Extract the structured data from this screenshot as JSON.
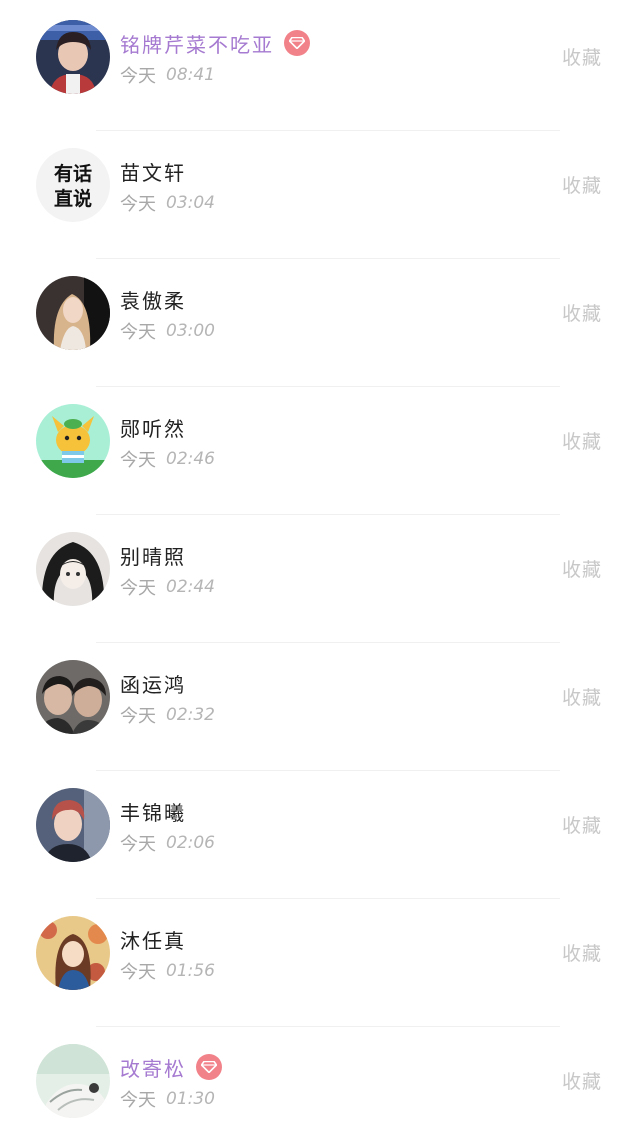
{
  "colors": {
    "vip_name": "#a57ad0",
    "vip_badge": "#f2828a",
    "name": "#222222",
    "secondary": "#a8a8a8",
    "favorite": "#c8c8c8"
  },
  "items": [
    {
      "name": "铭牌芹菜不吃亚",
      "vip": true,
      "day": "今天",
      "time": "08:41",
      "action": "收藏",
      "avatar_icon": "avatar-photo-icon"
    },
    {
      "name": "苗文轩",
      "vip": false,
      "day": "今天",
      "time": "03:04",
      "action": "收藏",
      "avatar_icon": "avatar-text-icon",
      "avatar_text": [
        "有话",
        "直说"
      ]
    },
    {
      "name": "袁傲柔",
      "vip": false,
      "day": "今天",
      "time": "03:00",
      "action": "收藏",
      "avatar_icon": "avatar-photo-icon"
    },
    {
      "name": "郧听然",
      "vip": false,
      "day": "今天",
      "time": "02:46",
      "action": "收藏",
      "avatar_icon": "avatar-cartoon-icon"
    },
    {
      "name": "别晴照",
      "vip": false,
      "day": "今天",
      "time": "02:44",
      "action": "收藏",
      "avatar_icon": "avatar-anime-icon"
    },
    {
      "name": "函运鸿",
      "vip": false,
      "day": "今天",
      "time": "02:32",
      "action": "收藏",
      "avatar_icon": "avatar-photo-icon"
    },
    {
      "name": "丰锦曦",
      "vip": false,
      "day": "今天",
      "time": "02:06",
      "action": "收藏",
      "avatar_icon": "avatar-photo-icon"
    },
    {
      "name": "沐任真",
      "vip": false,
      "day": "今天",
      "time": "01:56",
      "action": "收藏",
      "avatar_icon": "avatar-illustration-icon"
    },
    {
      "name": "改寄松",
      "vip": true,
      "day": "今天",
      "time": "01:30",
      "action": "收藏",
      "avatar_icon": "avatar-sketch-icon"
    }
  ]
}
